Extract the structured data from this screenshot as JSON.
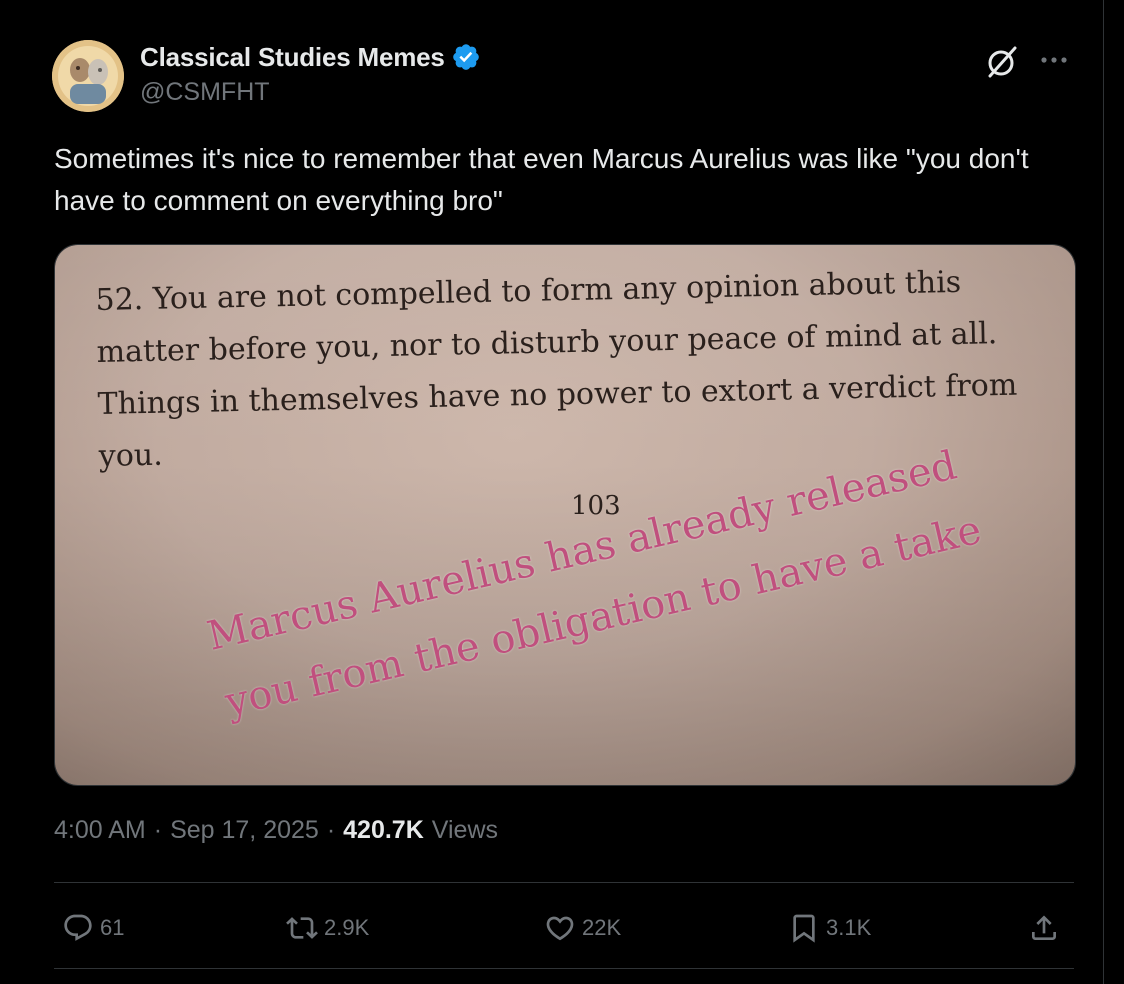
{
  "author": {
    "display_name": "Classical Studies Memes",
    "handle": "@CSMFHT",
    "verified": true
  },
  "tweet": {
    "text": "Sometimes it's nice to remember that even Marcus Aurelius was like \"you don't have to comment on everything bro\""
  },
  "media": {
    "quote_lines": [
      "52. You are not compelled to form any opinion about this",
      "matter before you, nor to disturb your peace of mind at all.",
      "Things in themselves have no power to extort a verdict from",
      "you."
    ],
    "page_number": "103",
    "overlay_lines": [
      "Marcus Aurelius has already released",
      "you from the obligation to have a take"
    ]
  },
  "meta": {
    "time": "4:00 AM",
    "separator": "·",
    "date": "Sep 17, 2025",
    "views_count": "420.7K",
    "views_label": "Views"
  },
  "actions": {
    "replies": "61",
    "reposts": "2.9K",
    "likes": "22K",
    "bookmarks": "3.1K"
  },
  "icons": {
    "verified": "verified-badge-icon",
    "grok": "grok-icon",
    "more": "more-options-icon",
    "reply": "reply-icon",
    "repost": "repost-icon",
    "like": "heart-icon",
    "bookmark": "bookmark-icon",
    "share": "share-icon"
  },
  "colors": {
    "background": "#000000",
    "text_primary": "#e7e9ea",
    "text_secondary": "#71767b",
    "verified_blue": "#1d9bf0",
    "overlay_pink": "#c0507e"
  }
}
